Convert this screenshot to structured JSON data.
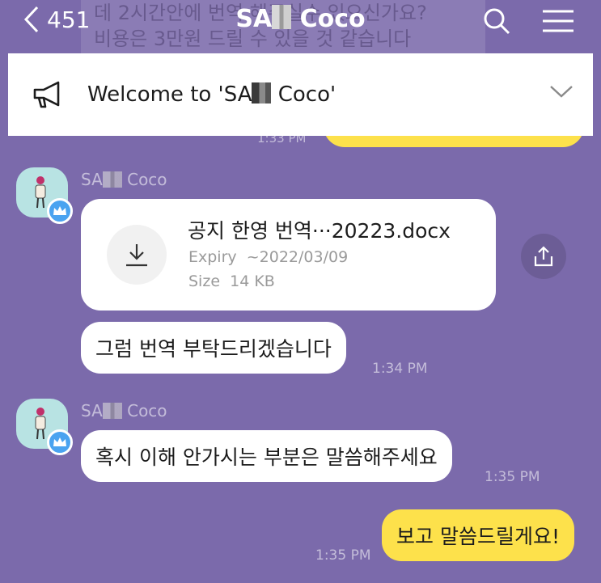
{
  "background_text": {
    "line1": "데 2시간안에 번역 해주실수 있으신가요?",
    "line2": "비용은 3만원 드릴 수 있을 것 같습니다",
    "partial_time": "1:33 PM"
  },
  "header": {
    "back_count": "451",
    "title_prefix": "SA",
    "title_suffix": "Coco"
  },
  "notice": {
    "text_prefix": "Welcome to 'SA",
    "text_suffix": "Coco'"
  },
  "messages": {
    "group1": {
      "sender_prefix": "SA",
      "sender_suffix": "Coco",
      "file": {
        "name": "공지 한영 번역···20223.docx",
        "expiry_label": "Expiry",
        "expiry_value": "~2022/03/09",
        "size_label": "Size",
        "size_value": "14 KB"
      },
      "text": "그럼 번역 부탁드리겠습니다",
      "time": "1:34 PM"
    },
    "group2": {
      "sender_prefix": "SA",
      "sender_suffix": "Coco",
      "text": "혹시 이해 안가시는 부분은 말씀해주세요",
      "time": "1:35 PM"
    },
    "mine": {
      "text": "보고 말씀드릴게요!",
      "time": "1:35 PM"
    }
  },
  "colors": {
    "background": "#7b6aab",
    "my_bubble": "#fde14b",
    "their_bubble": "#ffffff",
    "badge": "#4aa3f0"
  },
  "icons": [
    "chevron-left-icon",
    "search-icon",
    "menu-icon",
    "megaphone-icon",
    "chevron-down-icon",
    "download-icon",
    "share-icon",
    "crown-icon"
  ]
}
